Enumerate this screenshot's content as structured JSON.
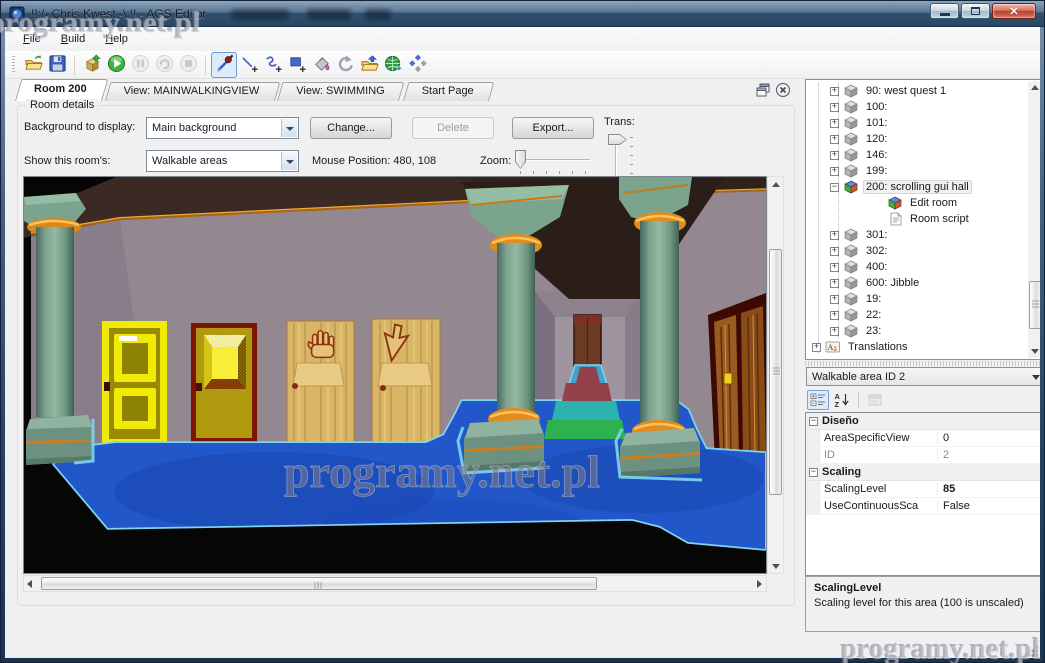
{
  "window": {
    "title": "!!:/- Chris Kwest -\\:!! - AGS Editor",
    "watermark": "programy.net.pl"
  },
  "menu": {
    "items": [
      "File",
      "Build",
      "Help"
    ]
  },
  "toolbar": {
    "buttons": [
      {
        "icon": "open-file-icon"
      },
      {
        "icon": "save-icon"
      },
      {
        "icon": "separator"
      },
      {
        "icon": "build-exe-icon"
      },
      {
        "icon": "run-icon"
      },
      {
        "icon": "pause-icon",
        "disabled": true
      },
      {
        "icon": "step-icon",
        "disabled": true
      },
      {
        "icon": "stop-icon",
        "disabled": true
      },
      {
        "icon": "separator"
      },
      {
        "icon": "select-tool-icon",
        "selected": true
      },
      {
        "icon": "line-tool-icon"
      },
      {
        "icon": "freehand-tool-icon"
      },
      {
        "icon": "rectangle-tool-icon"
      },
      {
        "icon": "fill-tool-icon"
      },
      {
        "icon": "undo-icon"
      },
      {
        "icon": "import-room-icon"
      },
      {
        "icon": "export-icon"
      },
      {
        "icon": "palette-icon"
      }
    ]
  },
  "tabs": {
    "items": [
      {
        "label": "Room 200",
        "active": true
      },
      {
        "label": "View: MAINWALKINGVIEW",
        "active": false
      },
      {
        "label": "View: SWIMMING",
        "active": false
      },
      {
        "label": "Start Page",
        "active": false
      }
    ]
  },
  "room_details": {
    "group_label": "Room details",
    "background_label": "Background to display:",
    "background_value": "Main background",
    "change_button": "Change...",
    "delete_button": "Delete",
    "export_button": "Export...",
    "trans_label": "Trans:",
    "show_label": "Show this room's:",
    "show_value": "Walkable areas",
    "mouse_position_label": "Mouse Position: 480, 108",
    "zoom_label": "Zoom:"
  },
  "project_tree": {
    "items": [
      {
        "label": "90: west quest 1",
        "icon": "room-gray-icon",
        "toggle": "+",
        "level": 1
      },
      {
        "label": "100:",
        "icon": "room-gray-icon",
        "toggle": "+",
        "level": 1
      },
      {
        "label": "101:",
        "icon": "room-gray-icon",
        "toggle": "+",
        "level": 1
      },
      {
        "label": "120:",
        "icon": "room-gray-icon",
        "toggle": "+",
        "level": 1
      },
      {
        "label": "146:",
        "icon": "room-gray-icon",
        "toggle": "+",
        "level": 1
      },
      {
        "label": "199:",
        "icon": "room-gray-icon",
        "toggle": "+",
        "level": 1
      },
      {
        "label": "200: scrolling gui hall",
        "icon": "room-color-icon",
        "toggle": "-",
        "level": 1,
        "selected": true
      },
      {
        "label": "Edit room",
        "icon": "room-color-icon",
        "toggle": null,
        "level": 2
      },
      {
        "label": "Room script",
        "icon": "script-icon",
        "toggle": null,
        "level": 2
      },
      {
        "label": "301:",
        "icon": "room-gray-icon",
        "toggle": "+",
        "level": 1
      },
      {
        "label": "302:",
        "icon": "room-gray-icon",
        "toggle": "+",
        "level": 1
      },
      {
        "label": "400:",
        "icon": "room-gray-icon",
        "toggle": "+",
        "level": 1
      },
      {
        "label": "600: Jibble",
        "icon": "room-gray-icon",
        "toggle": "+",
        "level": 1
      },
      {
        "label": "19:",
        "icon": "room-gray-icon",
        "toggle": "+",
        "level": 1
      },
      {
        "label": "22:",
        "icon": "room-gray-icon",
        "toggle": "+",
        "level": 1
      },
      {
        "label": "23:",
        "icon": "room-gray-icon",
        "toggle": "+",
        "level": 1
      },
      {
        "label": "Translations",
        "icon": "translations-icon",
        "toggle": "+",
        "level": 0
      }
    ]
  },
  "properties": {
    "selector_value": "Walkable area ID 2",
    "rows": [
      {
        "type": "category",
        "name": "Diseño"
      },
      {
        "type": "property",
        "name": "AreaSpecificView",
        "value": "0"
      },
      {
        "type": "property",
        "name": "ID",
        "value": "2",
        "muted": true
      },
      {
        "type": "category",
        "name": "Scaling"
      },
      {
        "type": "property",
        "name": "ScalingLevel",
        "value": "85",
        "bold_value": true
      },
      {
        "type": "property",
        "name": "UseContinuousSca",
        "value": "False"
      }
    ],
    "description_title": "ScalingLevel",
    "description_text": "Scaling level for this area (100 is unscaled)"
  },
  "colors": {
    "walkable_blue": "#2257c9",
    "walkable_outline": "#7fd4f0",
    "selection_yellow": "#f0ea04",
    "pillar_teal": "#77a18d",
    "wall_mauve": "#938790",
    "gold_trim": "#e08c1e",
    "titlebar_blue": "#32506e"
  }
}
